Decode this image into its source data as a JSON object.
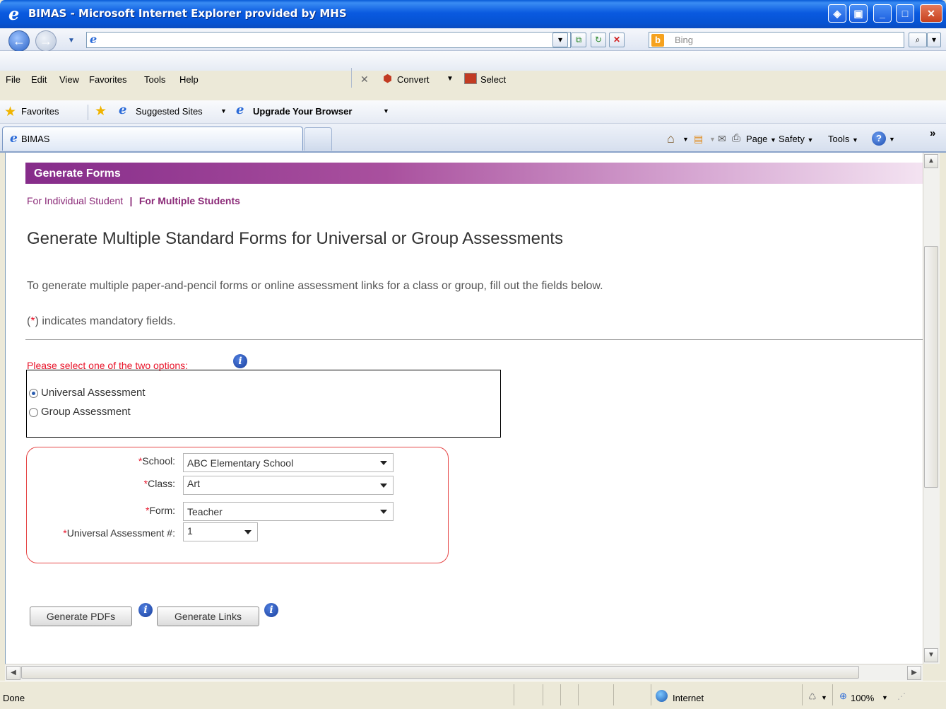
{
  "window": {
    "title": "BIMAS - Microsoft Internet Explorer provided by MHS",
    "logo": "e"
  },
  "address": {
    "value": "",
    "placeholder": ""
  },
  "search": {
    "placeholder": "Bing"
  },
  "menu": {
    "items": [
      "File",
      "Edit",
      "View",
      "Favorites",
      "Tools",
      "Help"
    ],
    "convert_label": "Convert",
    "select_label": "Select"
  },
  "favorites": {
    "label": "Favorites",
    "suggested_label": "Suggested Sites",
    "upgrade_label": "Upgrade Your Browser"
  },
  "tab": {
    "label": "BIMAS"
  },
  "command": {
    "page_label": "Page",
    "safety_label": "Safety",
    "tools_label": "Tools",
    "more_label": "»"
  },
  "page": {
    "banner": "Generate Forms",
    "nav": {
      "individual": "For Individual Student",
      "separator": "|",
      "multiple": "For Multiple Students"
    },
    "heading": "Generate Multiple Standard Forms for Universal or Group Assessments",
    "description": "To generate multiple paper-and-pencil forms or online assessment links for a class or group, fill out the fields below.",
    "mandatory_prefix": "(",
    "mandatory_star": "*",
    "mandatory_suffix": ") indicates mandatory fields.",
    "select_prompt": "Please select one of the two options:",
    "options": [
      "Universal Assessment",
      "Group Assessment"
    ],
    "selected_option": "Universal Assessment",
    "fields": {
      "star": "*",
      "school_label": "School:",
      "school_value": "ABC Elementary School",
      "class_label": "Class:",
      "class_value": "Art",
      "form_label": "Form:",
      "form_value": "Teacher",
      "ua_label": "Universal Assessment #:",
      "ua_value": "1"
    },
    "buttons": {
      "pdfs": "Generate PDFs",
      "links": "Generate Links"
    },
    "info_glyph": "i"
  },
  "status": {
    "left": "Done",
    "zone": "Internet",
    "zoom": "100%"
  },
  "colors": {
    "banner_start": "#862c8a",
    "link": "#8b2a78",
    "required": "#e8142a",
    "form_border": "#e64848"
  }
}
